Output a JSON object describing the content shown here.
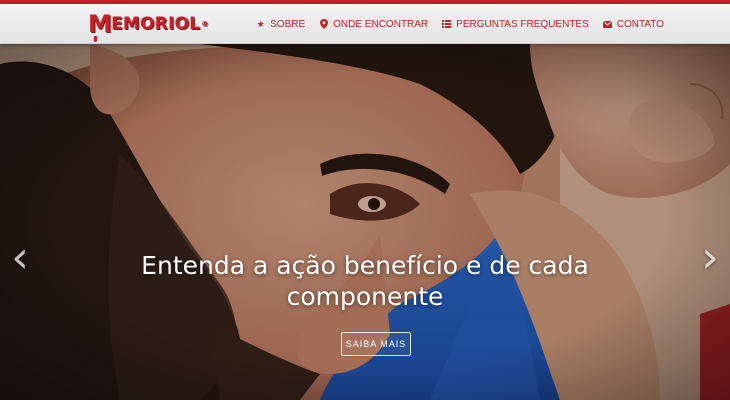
{
  "brand": {
    "name": "MEMORIOL",
    "first_letter": "M",
    "rest": "EMORIOL",
    "mark": "®",
    "color": "#c62127"
  },
  "nav": {
    "items": [
      {
        "label": "SOBRE",
        "icon": "star-icon"
      },
      {
        "label": "ONDE ENCONTRAR",
        "icon": "map-marker-icon"
      },
      {
        "label": "PERGUNTAS FREQUENTES",
        "icon": "list-icon"
      },
      {
        "label": "CONTATO",
        "icon": "envelope-icon"
      }
    ]
  },
  "hero": {
    "caption": "Entenda a ação benefício e de cada componente",
    "button_label": "SAIBA MAIS",
    "prev_icon": "chevron-left-icon",
    "next_icon": "chevron-right-icon"
  }
}
